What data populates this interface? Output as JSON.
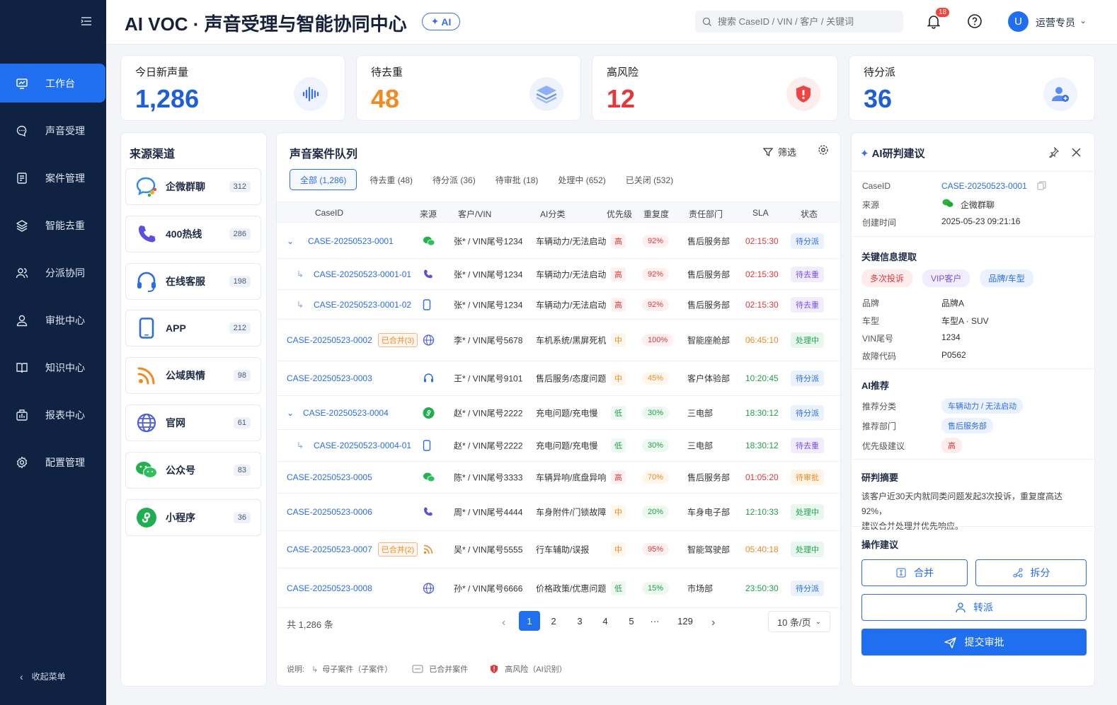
{
  "app": {
    "title": "AI VOC · 声音受理与智能协同中心",
    "ai_badge": "AI"
  },
  "search": {
    "placeholder": "搜索 CaseID / VIN / 客户 / 关键词"
  },
  "notifications": {
    "count": "18"
  },
  "user": {
    "avatar": "U",
    "name": "运营专员"
  },
  "sidebar": {
    "items": [
      {
        "label": "工作台",
        "icon": "dashboard-icon",
        "active": true
      },
      {
        "label": "声音受理",
        "icon": "chat-icon"
      },
      {
        "label": "案件管理",
        "icon": "document-icon"
      },
      {
        "label": "智能去重",
        "icon": "layers-icon"
      },
      {
        "label": "分派协同",
        "icon": "team-icon"
      },
      {
        "label": "审批中心",
        "icon": "approval-icon"
      },
      {
        "label": "知识中心",
        "icon": "book-icon"
      },
      {
        "label": "报表中心",
        "icon": "report-icon"
      },
      {
        "label": "配置管理",
        "icon": "settings-icon"
      }
    ],
    "collapse_label": "收起菜单"
  },
  "stats": [
    {
      "label": "今日新声量",
      "value": "1,286",
      "color": "#1f5fd6",
      "icon": "soundwave-icon"
    },
    {
      "label": "待去重",
      "value": "48",
      "color": "#f08a24",
      "icon": "layers-icon"
    },
    {
      "label": "高风险",
      "value": "12",
      "color": "#e5373a",
      "icon": "shield-alert-icon"
    },
    {
      "label": "待分派",
      "value": "36",
      "color": "#1f5fd6",
      "icon": "user-add-icon"
    }
  ],
  "channels": {
    "title": "来源渠道",
    "items": [
      {
        "name": "企微群聊",
        "count": "312",
        "icon": "wecom-icon"
      },
      {
        "name": "400热线",
        "count": "286",
        "icon": "phone-icon"
      },
      {
        "name": "在线客服",
        "count": "198",
        "icon": "headset-icon"
      },
      {
        "name": "APP",
        "count": "212",
        "icon": "mobile-icon"
      },
      {
        "name": "公域舆情",
        "count": "98",
        "icon": "rss-icon"
      },
      {
        "name": "官网",
        "count": "61",
        "icon": "globe-icon"
      },
      {
        "name": "公众号",
        "count": "83",
        "icon": "wechat-icon"
      },
      {
        "name": "小程序",
        "count": "36",
        "icon": "miniprogram-icon"
      }
    ]
  },
  "queue": {
    "title": "声音案件队列",
    "filter_label": "筛选",
    "tabs": [
      "全部 (1,286)",
      "待去重 (48)",
      "待分派 (36)",
      "待审批 (18)",
      "处理中 (652)",
      "已关闭 (532)"
    ],
    "columns": [
      "CaseID",
      "来源",
      "客户/VIN",
      "AI分类",
      "优先级",
      "重复度",
      "责任部门",
      "SLA",
      "状态"
    ],
    "rows": [
      {
        "id": "CASE-20250523-0001",
        "level": 0,
        "expand": true,
        "merged": "",
        "src": "wechat-icon",
        "cust": "张* / VIN尾号1234",
        "cat": "车辆动力/无法启动",
        "pri": "高",
        "dup": "92%",
        "dept": "售后服务部",
        "sla": "02:15:30",
        "status": "待分派"
      },
      {
        "id": "CASE-20250523-0001-01",
        "level": 1,
        "expand": false,
        "merged": "",
        "src": "phone-icon",
        "cust": "张* / VIN尾号1234",
        "cat": "车辆动力/无法启动",
        "pri": "高",
        "dup": "92%",
        "dept": "售后服务部",
        "sla": "02:15:30",
        "status": "待去重"
      },
      {
        "id": "CASE-20250523-0001-02",
        "level": 1,
        "expand": false,
        "merged": "",
        "src": "mobile-icon",
        "cust": "张* / VIN尾号1234",
        "cat": "车辆动力/无法启动",
        "pri": "高",
        "dup": "92%",
        "dept": "售后服务部",
        "sla": "02:15:30",
        "status": "待去重"
      },
      {
        "id": "CASE-20250523-0002",
        "level": 0,
        "expand": false,
        "merged": "已合并(3)",
        "src": "globe-icon",
        "cust": "李* / VIN尾号5678",
        "cat": "车机系统/黑屏死机",
        "pri": "中",
        "dup": "100%",
        "dept": "智能座舱部",
        "sla": "06:45:10",
        "status": "处理中"
      },
      {
        "id": "CASE-20250523-0003",
        "level": 0,
        "expand": false,
        "merged": "",
        "src": "headset-icon",
        "cust": "王* / VIN尾号9101",
        "cat": "售后服务/态度问题",
        "pri": "中",
        "dup": "45%",
        "dept": "客户体验部",
        "sla": "10:20:45",
        "status": "待分派"
      },
      {
        "id": "CASE-20250523-0004",
        "level": 0,
        "expand": true,
        "merged": "",
        "src": "miniprogram-icon",
        "cust": "赵* / VIN尾号2222",
        "cat": "充电问题/充电慢",
        "pri": "低",
        "dup": "30%",
        "dept": "三电部",
        "sla": "18:30:12",
        "status": "待分派"
      },
      {
        "id": "CASE-20250523-0004-01",
        "level": 1,
        "expand": false,
        "merged": "",
        "src": "mobile-icon",
        "cust": "赵* / VIN尾号2222",
        "cat": "充电问题/充电慢",
        "pri": "低",
        "dup": "30%",
        "dept": "三电部",
        "sla": "18:30:12",
        "status": "待去重"
      },
      {
        "id": "CASE-20250523-0005",
        "level": 0,
        "expand": false,
        "merged": "",
        "src": "wechat-icon",
        "cust": "陈* / VIN尾号3333",
        "cat": "车辆异响/底盘异响",
        "pri": "高",
        "dup": "70%",
        "dept": "售后服务部",
        "sla": "01:05:20",
        "status": "待审批"
      },
      {
        "id": "CASE-20250523-0006",
        "level": 0,
        "expand": false,
        "merged": "",
        "src": "phone-icon",
        "cust": "周* / VIN尾号4444",
        "cat": "车身附件/门锁故障",
        "pri": "中",
        "dup": "20%",
        "dept": "车身电子部",
        "sla": "12:10:33",
        "status": "处理中"
      },
      {
        "id": "CASE-20250523-0007",
        "level": 0,
        "expand": false,
        "merged": "已合并(2)",
        "src": "rss-icon",
        "cust": "吴* / VIN尾号5555",
        "cat": "行车辅助/误报",
        "pri": "中",
        "dup": "95%",
        "dept": "智能驾驶部",
        "sla": "05:40:18",
        "status": "处理中"
      },
      {
        "id": "CASE-20250523-0008",
        "level": 0,
        "expand": false,
        "merged": "",
        "src": "globe-icon",
        "cust": "孙* / VIN尾号6666",
        "cat": "价格政策/优惠问题",
        "pri": "低",
        "dup": "15%",
        "dept": "市场部",
        "sla": "23:50:30",
        "status": "待分派"
      }
    ],
    "total": "共 1,286 条",
    "pages": [
      "1",
      "2",
      "3",
      "4",
      "5",
      "···",
      "129"
    ],
    "page_size": "10 条/页",
    "legend": {
      "prefix": "说明:",
      "child": "母子案件（子案件）",
      "merged": "已合并案件",
      "risk": "高风险（AI识别）"
    }
  },
  "ai_panel": {
    "title": "AI研判建议",
    "case_label": "CaseID",
    "case_value": "CASE-20250523-0001",
    "source_label": "来源",
    "source_value": "企微群聊",
    "created_label": "创建时间",
    "created_value": "2025-05-23 09:21:16",
    "extract_title": "关键信息提取",
    "tags": [
      "多次投诉",
      "VIP客户",
      "品牌/车型"
    ],
    "fields": [
      {
        "k": "品牌",
        "v": "品牌A"
      },
      {
        "k": "车型",
        "v": "车型A · SUV"
      },
      {
        "k": "VIN尾号",
        "v": "1234"
      },
      {
        "k": "故障代码",
        "v": "P0562"
      }
    ],
    "rec_title": "AI推荐",
    "rec": [
      {
        "k": "推荐分类",
        "v": "车辆动力 / 无法启动"
      },
      {
        "k": "推荐部门",
        "v": "售后服务部"
      },
      {
        "k": "优先级建议",
        "v": "高"
      }
    ],
    "summary_title": "研判摘要",
    "summary_line1": "该客户近30天内就同类问题发起3次投诉，重复度高达92%，",
    "summary_line2": "建议合并处理并优先响应。",
    "ops_title": "操作建议",
    "btn_merge": "合并",
    "btn_split": "拆分",
    "btn_transfer": "转派",
    "btn_submit": "提交审批"
  }
}
